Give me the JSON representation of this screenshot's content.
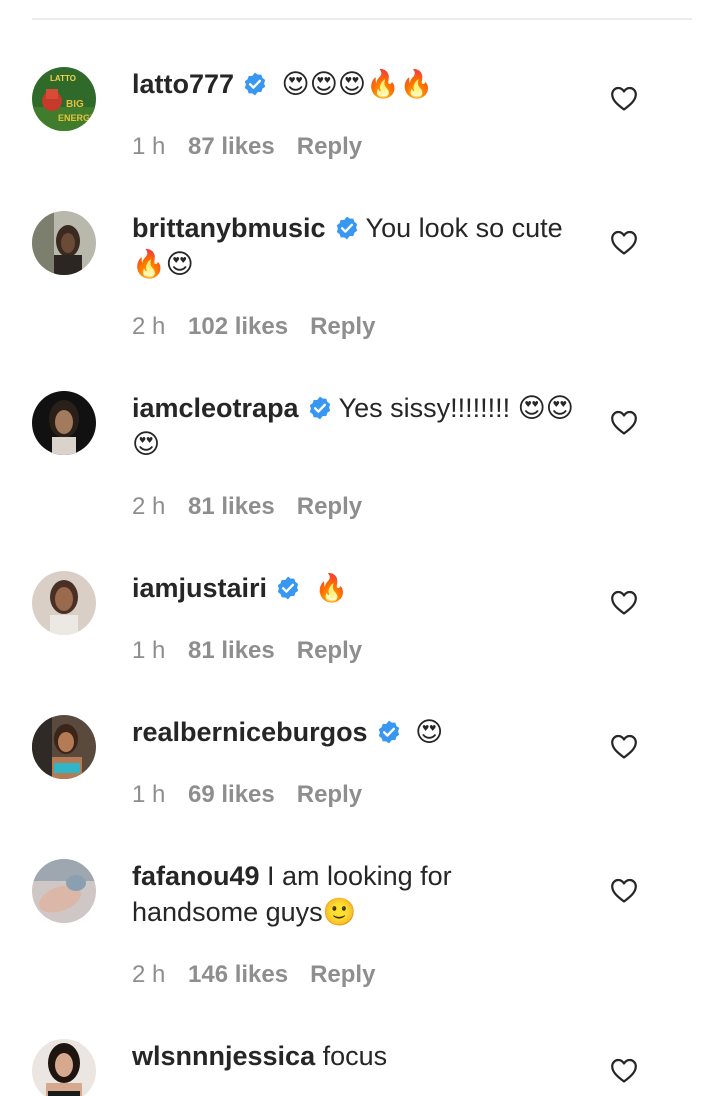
{
  "comments": [
    {
      "username": "latto777",
      "verified": true,
      "text": " 😍😍😍🔥🔥",
      "time": "1 h",
      "likes": "87 likes",
      "reply": "Reply",
      "avatar_icon": "latto-album-avatar",
      "avatar_color": "#2e6b2a"
    },
    {
      "username": "brittanybmusic",
      "verified": true,
      "text": "You look so cute 🔥😍",
      "time": "2 h",
      "likes": "102 likes",
      "reply": "Reply",
      "avatar_icon": "profile-photo-avatar",
      "avatar_color": "#8a8a7c"
    },
    {
      "username": "iamcleotrapa",
      "verified": true,
      "text": "Yes sissy!!!!!!!! 😍😍😍",
      "time": "2 h",
      "likes": "81 likes",
      "reply": "Reply",
      "avatar_icon": "profile-photo-avatar",
      "avatar_color": "#1c1c1c"
    },
    {
      "username": "iamjustairi",
      "verified": true,
      "text": " 🔥",
      "time": "1 h",
      "likes": "81 likes",
      "reply": "Reply",
      "avatar_icon": "profile-photo-avatar",
      "avatar_color": "#7a5a48"
    },
    {
      "username": "realberniceburgos",
      "verified": true,
      "text": " 😍",
      "time": "1 h",
      "likes": "69 likes",
      "reply": "Reply",
      "avatar_icon": "profile-photo-avatar",
      "avatar_color": "#4aa6b6"
    },
    {
      "username": "fafanou49",
      "verified": false,
      "text": " I am looking for handsome guys🙂",
      "time": "2 h",
      "likes": "146 likes",
      "reply": "Reply",
      "avatar_icon": "profile-photo-avatar",
      "avatar_color": "#c0a6a2"
    },
    {
      "username": "wlsnnnjessica",
      "verified": false,
      "text": " focus",
      "time": "",
      "likes": "",
      "reply": "",
      "avatar_icon": "profile-photo-avatar",
      "avatar_color": "#3a2a24"
    }
  ],
  "colors": {
    "verified_badge": "#3897f0",
    "text": "#262626",
    "meta": "#8e8e8e"
  }
}
